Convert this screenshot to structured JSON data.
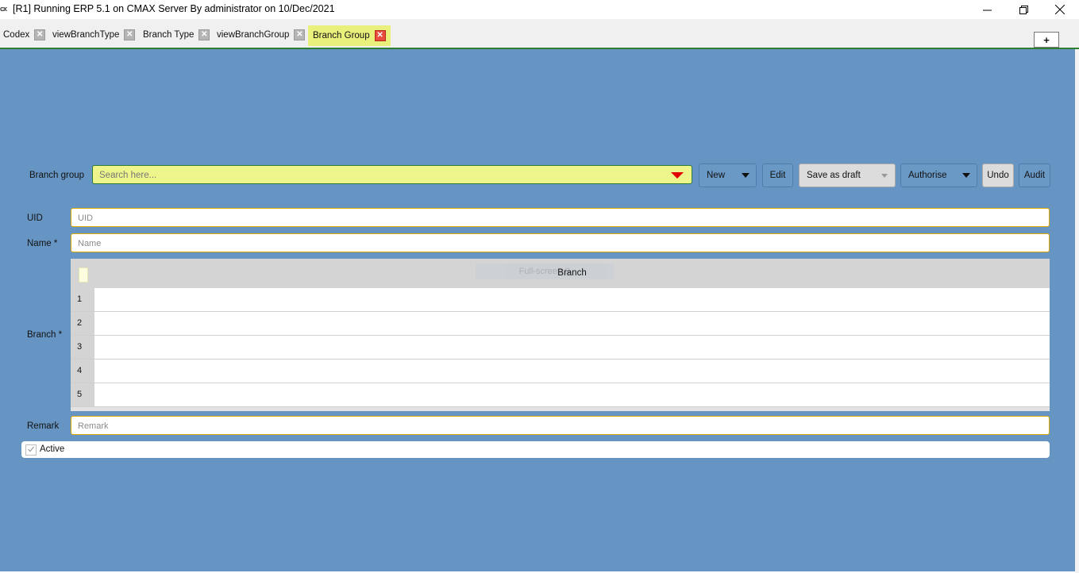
{
  "window": {
    "icon_text": "cx",
    "title": "[R1] Running ERP 5.1 on CMAX Server By administrator on 10/Dec/2021",
    "controls": {
      "minimize": "—",
      "maximize": "❐",
      "close": "✕"
    }
  },
  "tabs": [
    {
      "label": "Codex",
      "close": "✕",
      "active": false
    },
    {
      "label": "viewBranchType",
      "close": "✕",
      "active": false
    },
    {
      "label": "Branch Type",
      "close": "✕",
      "active": false
    },
    {
      "label": "viewBranchGroup",
      "close": "✕",
      "active": false
    },
    {
      "label": "Branch Group",
      "close": "✕",
      "active": true
    }
  ],
  "tab_add_label": "+",
  "toolbar": {
    "branch_group_label": "Branch group",
    "search_placeholder": "Search here...",
    "new_label": "New",
    "edit_label": "Edit",
    "save_draft_label": "Save as draft",
    "authorise_label": "Authorise",
    "undo_label": "Undo",
    "audit_label": "Audit"
  },
  "form": {
    "uid_label": "UID",
    "uid_placeholder": "UID",
    "name_label": "Name *",
    "name_placeholder": "Name",
    "branch_label": "Branch *",
    "remark_label": "Remark",
    "remark_placeholder": "Remark",
    "active_label": "Active",
    "active_checked": true
  },
  "grid": {
    "column": "Branch",
    "fullscreen_hint": "Full-screen S",
    "rows": [
      "1",
      "2",
      "3",
      "4",
      "5"
    ]
  },
  "colors": {
    "panel_bg": "#6695c3",
    "search_bg": "#eef58a",
    "active_tab_bg": "#e9f07c",
    "accent_green": "#2e7d32",
    "field_border": "#e0a800"
  }
}
